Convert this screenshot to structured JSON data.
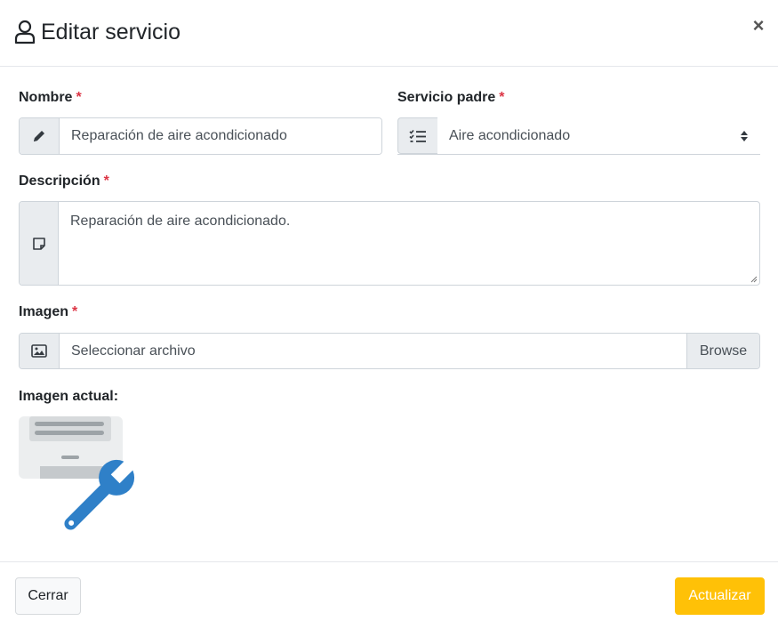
{
  "modal": {
    "title": "Editar servicio",
    "close_symbol": "×",
    "header_icon": "user-icon"
  },
  "form": {
    "nombre": {
      "label": "Nombre",
      "required": "*",
      "value": "Reparación de aire acondicionado",
      "icon": "pencil-icon"
    },
    "servicio_padre": {
      "label": "Servicio padre",
      "required": "*",
      "selected": "Aire acondicionado",
      "icon": "list-check-icon"
    },
    "descripcion": {
      "label": "Descripción",
      "required": "*",
      "value": "Reparación de aire acondicionado.",
      "icon": "sticky-note-icon"
    },
    "imagen": {
      "label": "Imagen",
      "required": "*",
      "placeholder": "Seleccionar archivo",
      "browse_label": "Browse",
      "icon": "image-icon"
    },
    "imagen_actual": {
      "label": "Imagen actual:",
      "picture": "air-conditioner-wrench-image"
    }
  },
  "footer": {
    "cancel_label": "Cerrar",
    "submit_label": "Actualizar"
  },
  "colors": {
    "required": "#dc3545",
    "submit": "#ffc107",
    "wrench": "#2f80c8"
  }
}
